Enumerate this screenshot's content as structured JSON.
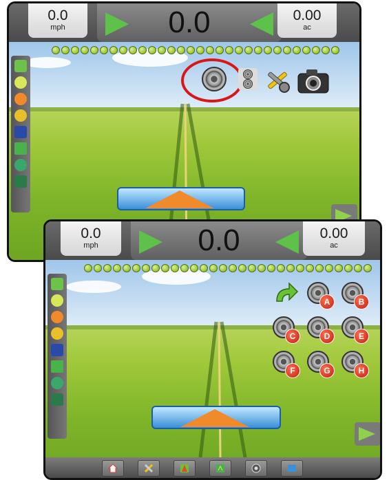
{
  "back_screen": {
    "speed": {
      "value": "0.0",
      "unit": "mph"
    },
    "guidance_value": "0.0",
    "area": {
      "value": "0.00",
      "unit": "ac"
    },
    "toolbar_icons": [
      "camera-select-icon",
      "dual-camera-icon",
      "tools-icon",
      "screenshot-camera-icon"
    ]
  },
  "front_screen": {
    "speed": {
      "value": "0.0",
      "unit": "mph"
    },
    "guidance_value": "0.0",
    "area": {
      "value": "0.00",
      "unit": "ac"
    },
    "cameras": [
      "A",
      "B",
      "C",
      "D",
      "E",
      "F",
      "G",
      "H"
    ],
    "bottom_tabs": [
      "home-icon",
      "tools-icon",
      "map-icon",
      "field-view-icon",
      "camera-icon",
      "camera-select-icon"
    ]
  }
}
